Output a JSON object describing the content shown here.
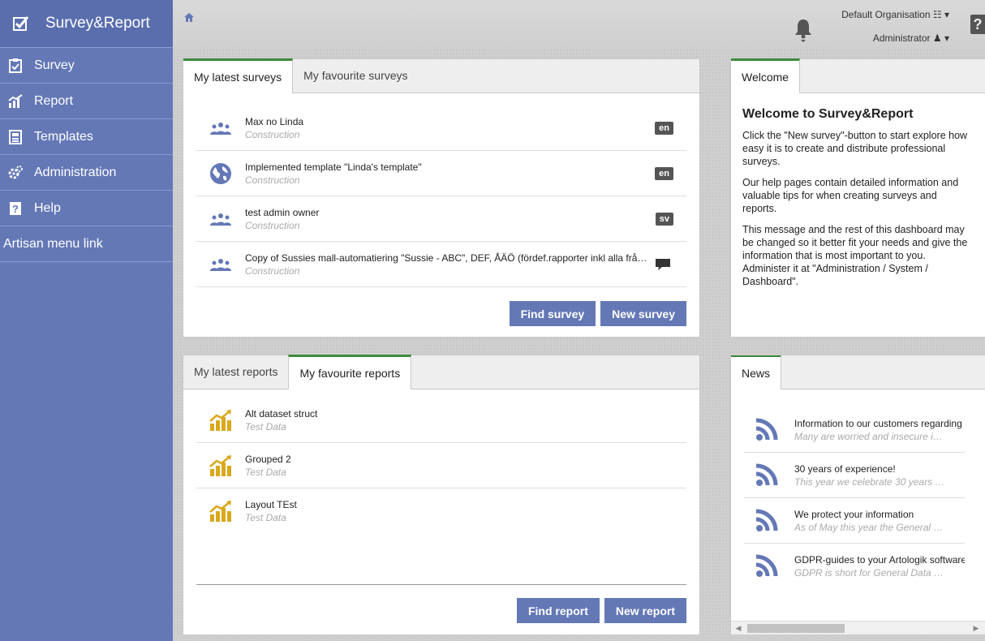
{
  "sidebar": {
    "brand": "Survey&Report",
    "items": [
      {
        "label": "Survey",
        "icon": "clipboard-check-icon"
      },
      {
        "label": "Report",
        "icon": "chart-icon"
      },
      {
        "label": "Templates",
        "icon": "template-icon"
      },
      {
        "label": "Administration",
        "icon": "gears-icon"
      },
      {
        "label": "Help",
        "icon": "help-book-icon"
      },
      {
        "label": "Artisan menu link",
        "icon": ""
      }
    ]
  },
  "header": {
    "organisation": "Default Organisation",
    "user": "Administrator",
    "help": "?"
  },
  "surveys": {
    "tabs": [
      "My latest surveys",
      "My favourite surveys"
    ],
    "items": [
      {
        "title": "Max no Linda",
        "subtitle": "Construction",
        "badge": "en",
        "icon": "users-icon"
      },
      {
        "title": "Implemented template \"Linda's template\"",
        "subtitle": "Construction",
        "badge": "en",
        "icon": "globe-icon"
      },
      {
        "title": "test admin owner",
        "subtitle": "Construction",
        "badge": "sv",
        "icon": "users-icon"
      },
      {
        "title": "Copy of Sussies mall-automatiering \"Sussie - ABC\", DEF, ÅÄÖ (fördef.rapporter inkl alla frågetyper)",
        "subtitle": "Construction",
        "badge": "",
        "icon": "users-icon"
      }
    ],
    "find_label": "Find survey",
    "new_label": "New survey"
  },
  "reports": {
    "tabs": [
      "My latest reports",
      "My favourite reports"
    ],
    "items": [
      {
        "title": "Alt dataset struct",
        "subtitle": "Test Data"
      },
      {
        "title": "Grouped 2",
        "subtitle": "Test Data"
      },
      {
        "title": "Layout TEst",
        "subtitle": "Test Data"
      }
    ],
    "find_label": "Find report",
    "new_label": "New report"
  },
  "welcome": {
    "tab": "Welcome",
    "title": "Welcome to Survey&Report",
    "p1": "Click the \"New survey\"-button to start explore how easy it is to create and distribute professional surveys.",
    "p2": "Our help pages contain detailed information and valuable tips for when creating surveys and reports.",
    "p3": "This message and the rest of this dashboard may be changed so it better fit your needs and give the information that is most important to you. Administer it at \"Administration / System / Dashboard\"."
  },
  "news": {
    "tab": "News",
    "items": [
      {
        "title": "Information to our customers regarding C",
        "subtitle": "Many are worried and insecure i…"
      },
      {
        "title": "30 years of experience!",
        "subtitle": "This year we celebrate 30 years …"
      },
      {
        "title": "We protect your information",
        "subtitle": "As of May this year the General …"
      },
      {
        "title": "GDPR-guides to your Artologik software",
        "subtitle": "GDPR is short for General Data …"
      }
    ]
  },
  "colors": {
    "sidebar": "#6478b6",
    "button": "#6478b6",
    "tab_accent": "#3d8a3d",
    "report_icon": "#d9a81c",
    "user_icon": "#6478b6",
    "rss_icon": "#6478b6"
  }
}
